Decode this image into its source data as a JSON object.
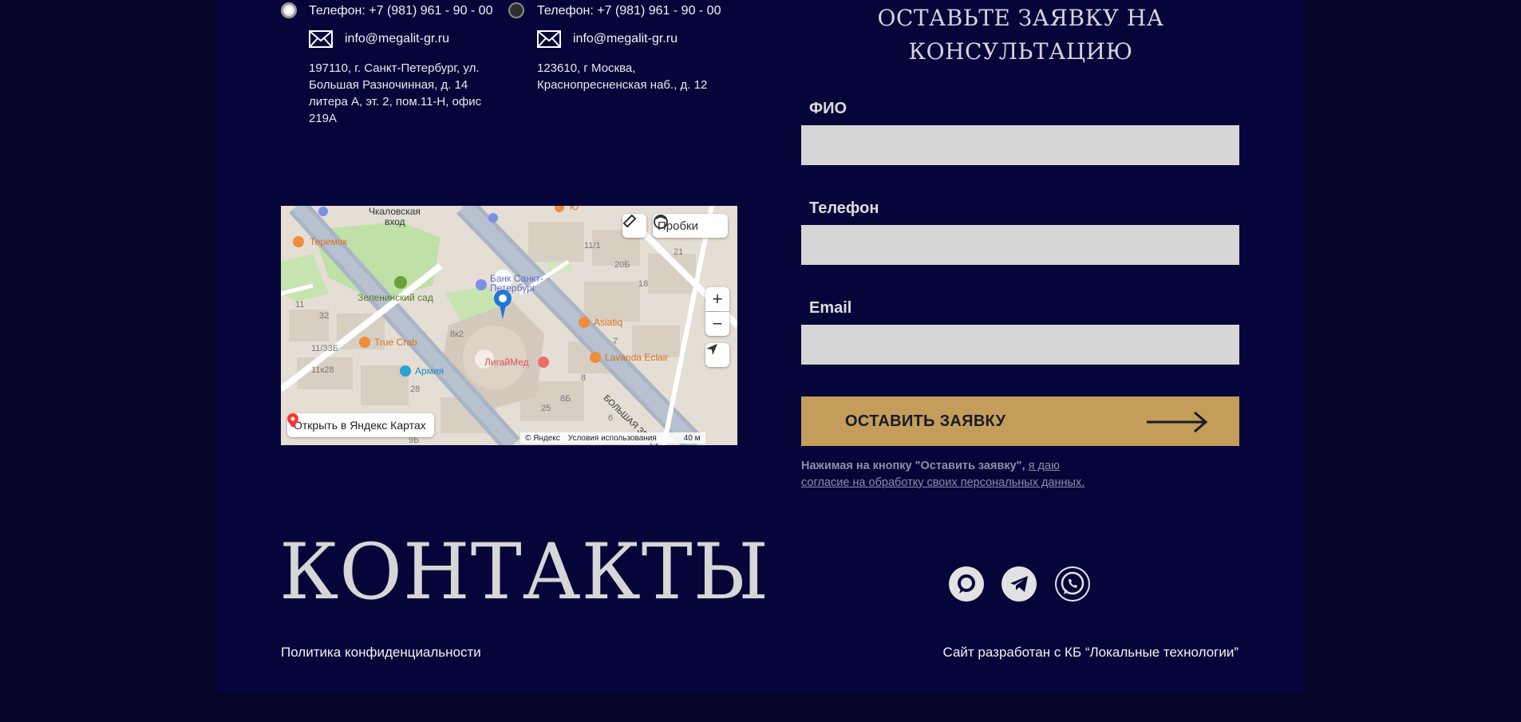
{
  "offices": [
    {
      "phone": "Телефон: +7 (981) 961 - 90 - 00",
      "email": "info@megalit-gr.ru",
      "address_lines": [
        "197110, г. Санкт-Петербург, ул.",
        "Большая Разночинная, д. 14",
        "литера А, эт. 2, пом.11-Н, офис",
        "219А"
      ]
    },
    {
      "phone": "Телефон: +7 (981) 961 - 90 - 00",
      "email": "info@megalit-gr.ru",
      "address_lines": [
        "123610, г Москва,",
        "Краснопресненская наб., д. 12"
      ]
    }
  ],
  "map": {
    "traffic_label": "Пробки",
    "open_label": "Открыть в Яндекс Картах",
    "copyright": "© Яндекс",
    "terms": "Условия использования",
    "scale": "40 м",
    "labels": {
      "chkalovskaya": "Чкаловская",
      "vhod": "вход",
      "teremok": "Теремок",
      "zeleninsky": "Зеленинский сад",
      "bank1": "Банк Санкт-",
      "bank2": "Петербург",
      "asiatiq": "Asiatiq",
      "truecrab": "True Crab",
      "ligaimed": "ЛигайМед",
      "lavanda": "Lavanda Eclair",
      "armiya": "Армия",
      "street": "БОЛЬШАЯ ЗЕЛЕНИН",
      "n11_1": "11/1",
      "n20b": "20Б",
      "n21": "21",
      "n18": "18",
      "n11": "11",
      "n32": "32",
      "n8k2": "8к2",
      "n11_33b": "11/33Б",
      "n11k28": "11к28",
      "n28": "28",
      "n7": "7",
      "n8": "8",
      "n8b": "8Б",
      "n25": "25",
      "n6": "6",
      "n9b": "9Б",
      "nyu": "Ю"
    }
  },
  "form": {
    "title_line1": "ОСТАВЬТЕ ЗАЯВКУ НА",
    "title_line2": "КОНСУЛЬТАЦИЮ",
    "fio_label": "ФИО",
    "phone_label": "Телефон",
    "email_label": "Email",
    "submit_label": "ОСТАВИТЬ ЗАЯВКУ",
    "consent_prefix": "Нажимая на кнопку \"Оставить заявку\", ",
    "consent_link": "я даю согласие на обработку своих персональных данных."
  },
  "footer": {
    "big_title": "КОНТАКТЫ",
    "privacy_link": "Политика конфиденциальности",
    "credit": "Сайт разработан с КБ “Локальные технологии”"
  },
  "colors": {
    "page_bg": "#040428",
    "panel_bg": "#05053a",
    "button_gold": "#c49d5a",
    "input_bg": "#d6d6d6"
  },
  "icons": {
    "radio_1": "radio-selected-icon",
    "radio_2": "radio-icon",
    "mail": "envelope-icon",
    "social": [
      "max-messenger-icon",
      "telegram-icon",
      "whatsapp-icon"
    ]
  }
}
